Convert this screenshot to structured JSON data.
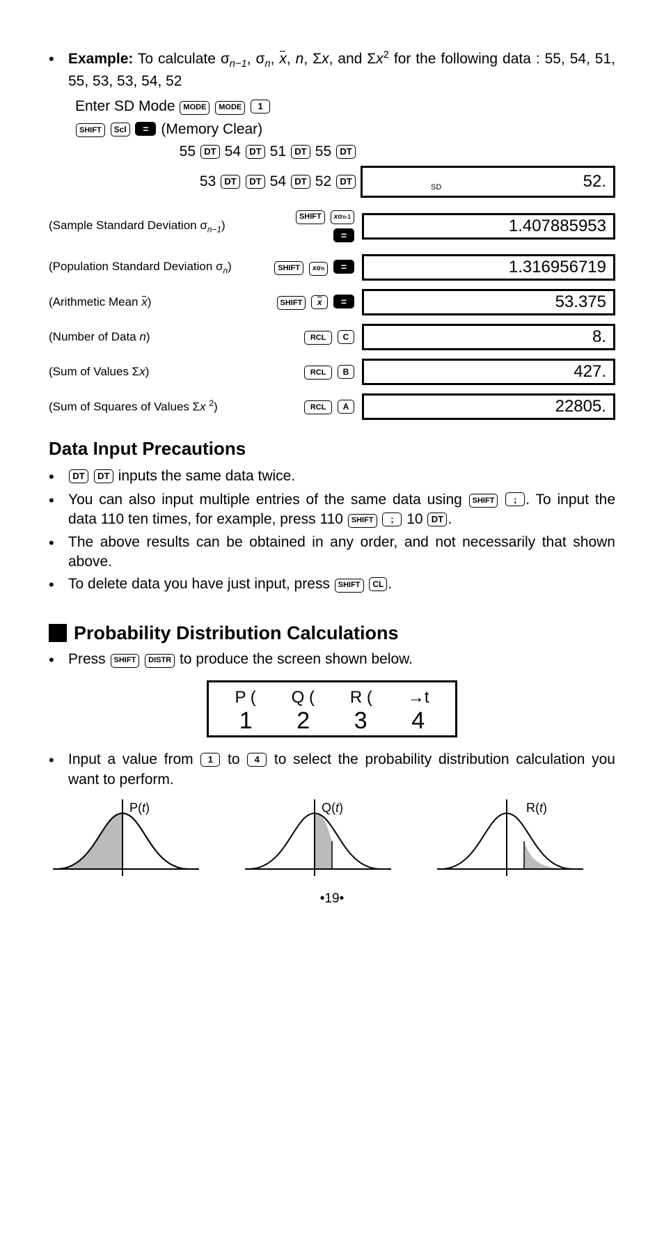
{
  "example": {
    "label": "Example:",
    "intro_a": " To calculate σ",
    "intro_b": ", σ",
    "intro_c": ", ",
    "intro_d": ", ",
    "intro_e": ", Σ",
    "intro_f": ", and Σ",
    "intro_g": " for the following data : 55, 54, 51, 55, 53, 53, 54, 52",
    "n_minus_1": "n−1",
    "n": "n",
    "xbar": "x̄",
    "nvar": "n",
    "sigx": "x",
    "sigx2": "x",
    "sq": "2",
    "enter_sd": "Enter SD Mode ",
    "memclear": " (Memory Clear)",
    "datavals": [
      "55",
      "54",
      "51",
      "55",
      "53",
      "54",
      "52"
    ],
    "first_result": "52.",
    "sd_tag": "SD"
  },
  "keys": {
    "mode": "MODE",
    "one": "1",
    "four": "4",
    "shift": "SHIFT",
    "scl": "Scl",
    "eq": "=",
    "dt": "DT",
    "xsn1": "xσn-1",
    "xsn": "xσn",
    "xbar_key": "x",
    "rcl": "RCL",
    "C": "C",
    "B": "B",
    "A": "A",
    "semi": ";",
    "cl": "CL",
    "distr": "DISTR"
  },
  "results": [
    {
      "label_a": "(Sample Standard Deviation σ",
      "sub": "n−1",
      "label_b": ")",
      "k1": "SHIFT",
      "k2": "xσn-1",
      "val": "1.407885953"
    },
    {
      "label_a": "(Population Standard Deviation σ",
      "sub": "n",
      "label_b": ")",
      "k1": "SHIFT",
      "k2": "xσn",
      "val": "1.316956719"
    },
    {
      "label_a": "(Arithmetic Mean ",
      "sub": "x̄",
      "label_b": ")",
      "k1": "SHIFT",
      "k2": "x̄",
      "val": "53.375",
      "xbar": true
    },
    {
      "label_a": "(Number of Data ",
      "sub": "n",
      "label_b": ")",
      "k1": "RCL",
      "k2": "C",
      "val": "8.",
      "plain": true
    },
    {
      "label_a": "(Sum of  Values Σ",
      "sub": "x",
      "label_b": ")",
      "k1": "RCL",
      "k2": "B",
      "val": "427.",
      "ital": true
    },
    {
      "label_a": "(Sum of Squares of Values Σ",
      "sub": "x ",
      "sup": "2",
      "label_b": ")",
      "k1": "RCL",
      "k2": "A",
      "val": "22805.",
      "ital": true
    }
  ],
  "precautions": {
    "title": "Data Input Precautions",
    "b1": " inputs the same data twice.",
    "b2a": "You can also input multiple entries of the same data using ",
    "b2b": ". To input the data 110 ten times, for example, press 110 ",
    "b2c": " 10",
    "b2d": ".",
    "b3": "The above results can be obtained in any order, and not necessarily that shown above.",
    "b4a": "To delete data you have just input, press ",
    "b4b": "."
  },
  "prob": {
    "title": "Probability Distribution Calculations",
    "p1a": "Press ",
    "p1b": " to produce the screen shown below.",
    "row1": [
      "P (",
      "Q (",
      "R (",
      "→t"
    ],
    "row2": [
      "1",
      "2",
      "3",
      "4"
    ],
    "p2a": "Input a value from ",
    "p2b": " to ",
    "p2c": " to select the probability distribution calculation you want to perform.",
    "labels": [
      "P(",
      "Q(",
      "R("
    ],
    "t": "t",
    "close": ")"
  },
  "page": "19"
}
